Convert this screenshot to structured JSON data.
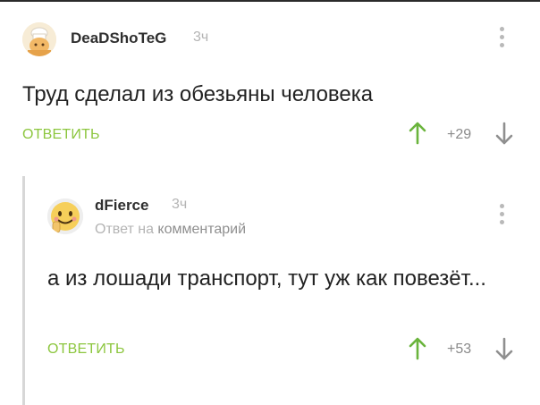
{
  "colors": {
    "accent": "#8cc63e",
    "vote_up": "#6ab43c",
    "vote_down": "#8f8f8f",
    "meta": "#b4b4b4",
    "text": "#222222"
  },
  "comments": [
    {
      "author": "DeaDShoTeG",
      "time": "3ч",
      "avatar_icon": "chef-avatar-icon",
      "text": "Труд сделал из обезьяны человека",
      "reply_label": "ОТВЕТИТЬ",
      "score": "+29"
    },
    {
      "author": "dFierce",
      "time": "3ч",
      "avatar_icon": "smiling-face-avatar-icon",
      "reply_to_prefix": "Ответ на",
      "reply_to_target": "комментарий",
      "text": "а из лошади транспорт, тут уж как повезёт...",
      "reply_label": "ОТВЕТИТЬ",
      "score": "+53"
    }
  ]
}
